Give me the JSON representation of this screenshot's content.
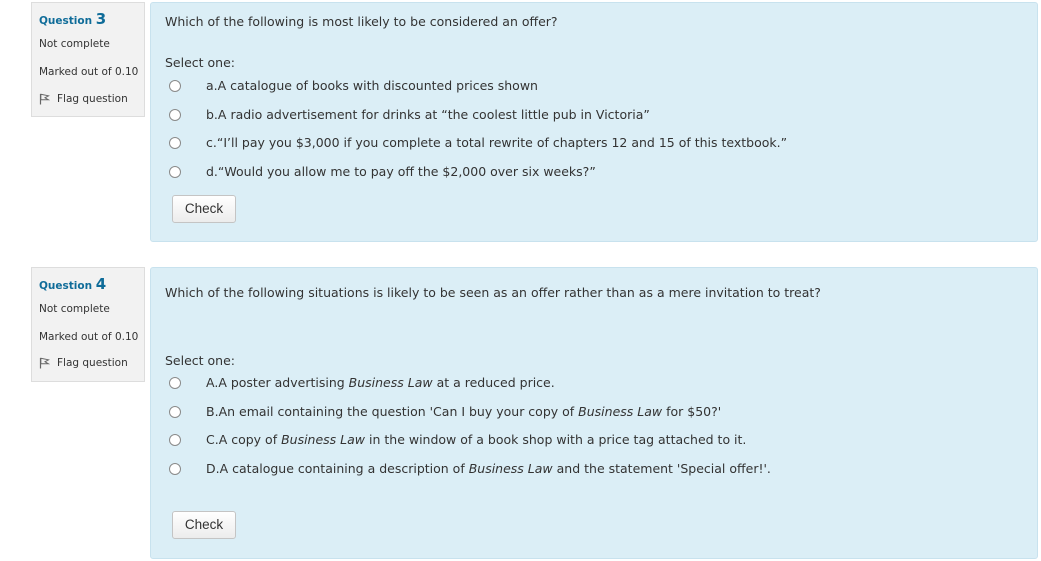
{
  "questions": [
    {
      "prefix": "Question",
      "number": "3",
      "state": "Not complete",
      "grade": "Marked out of 0.10",
      "flag_label": "Flag question",
      "text": "Which of the following is most likely to be considered an offer?",
      "prompt": "Select one:",
      "options": [
        {
          "letter": "a.",
          "parts": [
            {
              "t": "A catalogue of books with discounted prices shown"
            }
          ]
        },
        {
          "letter": "b.",
          "parts": [
            {
              "t": "A radio advertisement for drinks at “the coolest little pub in Victoria”"
            }
          ]
        },
        {
          "letter": "c.",
          "parts": [
            {
              "t": "“I’ll pay you $3,000 if you complete a total rewrite of chapters 12 and 15 of this textbook.”"
            }
          ]
        },
        {
          "letter": "d.",
          "parts": [
            {
              "t": "“Would you allow me to pay off the $2,000 over six weeks?”"
            }
          ]
        }
      ],
      "check_label": "Check"
    },
    {
      "prefix": "Question",
      "number": "4",
      "state": "Not complete",
      "grade": "Marked out of 0.10",
      "flag_label": "Flag question",
      "text": "Which of the following situations is likely to be seen as an offer rather than as a mere invitation to treat?",
      "prompt": "Select one:",
      "options": [
        {
          "letter": "A.",
          "parts": [
            {
              "t": "A poster advertising "
            },
            {
              "t": "Business Law",
              "em": true
            },
            {
              "t": " at a reduced price."
            }
          ]
        },
        {
          "letter": "B.",
          "parts": [
            {
              "t": "An email containing the question 'Can I buy your copy of "
            },
            {
              "t": "Business Law",
              "em": true
            },
            {
              "t": " for $50?'"
            }
          ]
        },
        {
          "letter": "C.",
          "parts": [
            {
              "t": "A copy of "
            },
            {
              "t": "Business Law",
              "em": true
            },
            {
              "t": " in the window of a book shop with a price tag attached to it."
            }
          ]
        },
        {
          "letter": "D.",
          "parts": [
            {
              "t": "A catalogue containing a description of "
            },
            {
              "t": "Business Law",
              "em": true
            },
            {
              "t": " and the statement 'Special offer!'."
            }
          ]
        }
      ],
      "check_label": "Check"
    }
  ]
}
